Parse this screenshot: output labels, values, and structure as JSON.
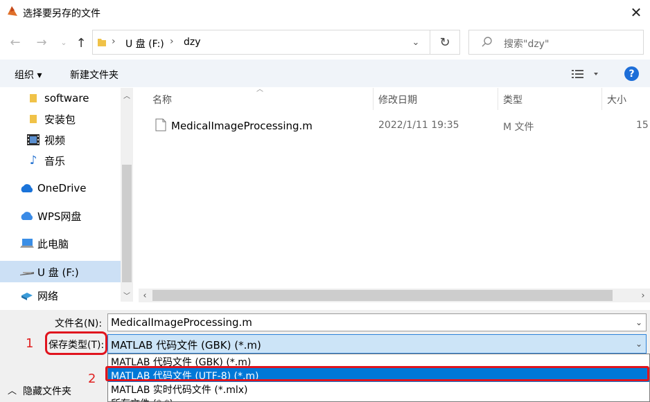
{
  "window": {
    "title": "选择要另存的文件"
  },
  "navbar": {
    "breadcrumb": [
      "U 盘 (F:)",
      "dzy"
    ],
    "search_placeholder": "搜索\"dzy\""
  },
  "toolbar": {
    "organize": "组织 ▾",
    "new_folder": "新建文件夹",
    "help": "?"
  },
  "nav_pane": {
    "items": [
      "software",
      "安装包",
      "视频",
      "音乐",
      "OneDrive",
      "WPS网盘",
      "此电脑",
      "U 盘 (F:)",
      "网络"
    ],
    "selected": "U 盘 (F:)"
  },
  "file_list": {
    "columns": [
      "名称",
      "修改日期",
      "类型",
      "大小"
    ],
    "rows": [
      {
        "name": "MedicalImageProcessing.m",
        "date": "2022/1/11 19:35",
        "type": "M 文件",
        "size": "15"
      }
    ]
  },
  "form": {
    "filename_label": "文件名(N):",
    "filename_value": "MedicalImageProcessing.m",
    "type_label": "保存类型(T):",
    "type_value": "MATLAB 代码文件 (GBK) (*.m)",
    "type_options": [
      "MATLAB 代码文件 (GBK) (*.m)",
      "MATLAB 代码文件 (UTF-8) (*.m)",
      "MATLAB 实时代码文件 (*.mlx)",
      "所有文件 (*.*)"
    ],
    "highlighted_option": "MATLAB 代码文件 (UTF-8) (*.m)"
  },
  "footer": {
    "hide_folders": "隐藏文件夹"
  },
  "annotations": [
    "1",
    "2"
  ],
  "colors": {
    "accent": "#0078d7",
    "annotation_red": "#e0141e",
    "selection": "#cce0f5"
  }
}
